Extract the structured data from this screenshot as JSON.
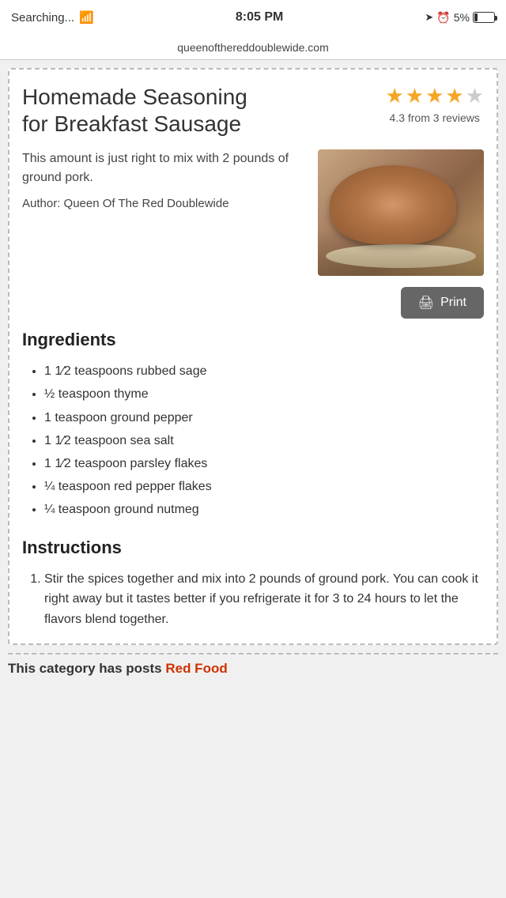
{
  "status_bar": {
    "left": "Searching...",
    "wifi": "📶",
    "time": "8:05 PM",
    "battery_percent": "5%"
  },
  "address_bar": {
    "url": "queenofthereddoublewide.com"
  },
  "recipe": {
    "title": "Homemade Seasoning for Breakfast Sausage",
    "rating": {
      "value": "4.3",
      "text": "4.3 from 3 reviews",
      "filled_stars": 4,
      "total_stars": 5
    },
    "description": "This amount is just right to mix with 2 pounds of ground pork.",
    "author_label": "Author:",
    "author_name": "Queen Of The Red Doublewide",
    "print_button": "Print",
    "sections": {
      "ingredients_title": "Ingredients",
      "ingredients": [
        "1 1⁄2 teaspoons rubbed sage",
        "½ teaspoon thyme",
        "1 teaspoon ground pepper",
        "1 1⁄2 teaspoon sea salt",
        "1 1⁄2 teaspoon parsley flakes",
        "¼ teaspoon red pepper flakes",
        "¼ teaspoon ground nutmeg"
      ],
      "instructions_title": "Instructions",
      "instructions": [
        "Stir the spices together and mix into 2 pounds of ground pork. You can cook it right away but it tastes better if you refrigerate it for 3 to 24 hours to let the flavors blend together."
      ]
    },
    "bottom_teaser": "This category has posts"
  }
}
